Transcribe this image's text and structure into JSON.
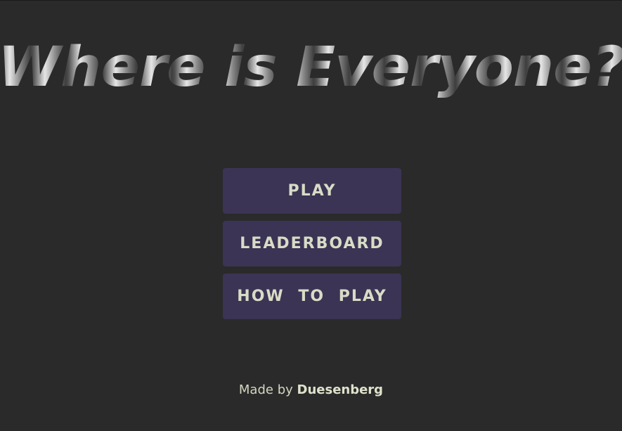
{
  "game": {
    "title": "Where is Everyone?"
  },
  "menu": {
    "play_label": "PLAY",
    "leaderboard_label": "LEADERBOARD",
    "how_to_play_label": "HOW TO PLAY"
  },
  "footer": {
    "made_by_prefix": "Made by",
    "author": "Duesenberg"
  },
  "colors": {
    "background": "#2a2a2a",
    "button_bg": "#3b3455",
    "button_text": "#d9dcc6",
    "footer_text": "#d3d6c0"
  }
}
